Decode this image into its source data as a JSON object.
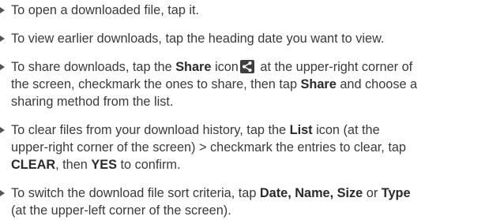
{
  "items": [
    {
      "line1": "To open a downloaded file, tap it."
    },
    {
      "line1": "To view earlier downloads, tap the heading date you want to view."
    },
    {
      "line1_a": "To share downloads, tap the ",
      "line1_b": "Share",
      "line1_c": " icon",
      "line1_d": " at the upper-right corner of",
      "line2": "the screen, checkmark the ones to share, then tap ",
      "line2_b": "Share",
      "line2_c": " and choose a",
      "line3": "sharing method from the list.",
      "icon": "share-icon"
    },
    {
      "line1_a": "To clear files from your download history, tap the ",
      "line1_b": "List",
      "line1_c": " icon (at the",
      "line2_a": "upper-right corner of the screen) > checkmark the entries to clear, tap",
      "line3_a": "CLEAR",
      "line3_b": ", then ",
      "line3_c": "YES",
      "line3_d": " to confirm."
    },
    {
      "line1_a": "To switch the download file sort criteria, tap ",
      "line1_b": "Date, Name, Size",
      "line1_c": " or ",
      "line1_d": "Type",
      "line2": "(at the upper-left corner of the screen)."
    }
  ]
}
